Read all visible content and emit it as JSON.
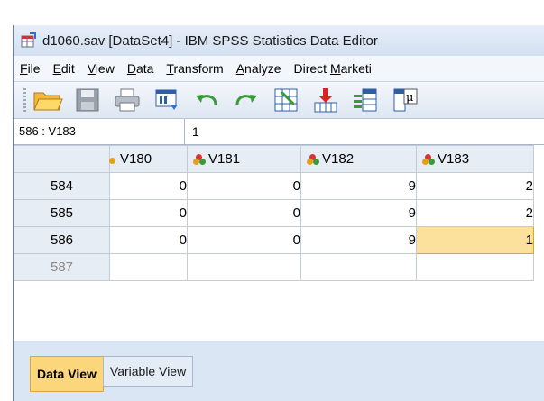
{
  "window": {
    "title": "d1060.sav [DataSet4] - IBM SPSS Statistics Data Editor"
  },
  "menubar": {
    "items": [
      {
        "label": "File",
        "ul": "F",
        "rest": "ile"
      },
      {
        "label": "Edit",
        "ul": "E",
        "rest": "dit"
      },
      {
        "label": "View",
        "ul": "V",
        "rest": "iew"
      },
      {
        "label": "Data",
        "ul": "D",
        "rest": "ata"
      },
      {
        "label": "Transform",
        "ul": "T",
        "rest": "ransform"
      },
      {
        "label": "Analyze",
        "ul": "A",
        "rest": "nalyze"
      },
      {
        "label": "Direct Marketi",
        "pre": "Direct ",
        "ul": "M",
        "rest": "arketi"
      }
    ]
  },
  "toolbar": {
    "buttons": [
      {
        "icon": "open-folder-icon"
      },
      {
        "icon": "save-icon"
      },
      {
        "icon": "print-icon"
      },
      {
        "icon": "recall-dialog-icon"
      },
      {
        "icon": "undo-icon"
      },
      {
        "icon": "redo-icon"
      },
      {
        "icon": "goto-case-icon"
      },
      {
        "icon": "goto-variable-icon"
      },
      {
        "icon": "variables-icon"
      },
      {
        "icon": "run-descriptives-icon"
      }
    ]
  },
  "cell_editor": {
    "reference": "586 : V183",
    "value": "1"
  },
  "grid": {
    "columns": [
      "V180",
      "V181",
      "V182",
      "V183"
    ],
    "rows": [
      {
        "row": "584",
        "values": [
          "0",
          "0",
          "9",
          "2"
        ]
      },
      {
        "row": "585",
        "values": [
          "0",
          "0",
          "9",
          "2"
        ]
      },
      {
        "row": "586",
        "values": [
          "0",
          "0",
          "9",
          "1"
        ]
      },
      {
        "row": "587",
        "values": [
          "",
          "",
          "",
          ""
        ]
      }
    ],
    "selected": {
      "row": "586",
      "column": "V183"
    }
  },
  "tabs": {
    "data_view": "Data View",
    "variable_view": "Variable View"
  },
  "colors": {
    "selected_cell": "#fbe19b",
    "active_tab": "#fbd67a",
    "header_bg": "#e7edf5"
  }
}
